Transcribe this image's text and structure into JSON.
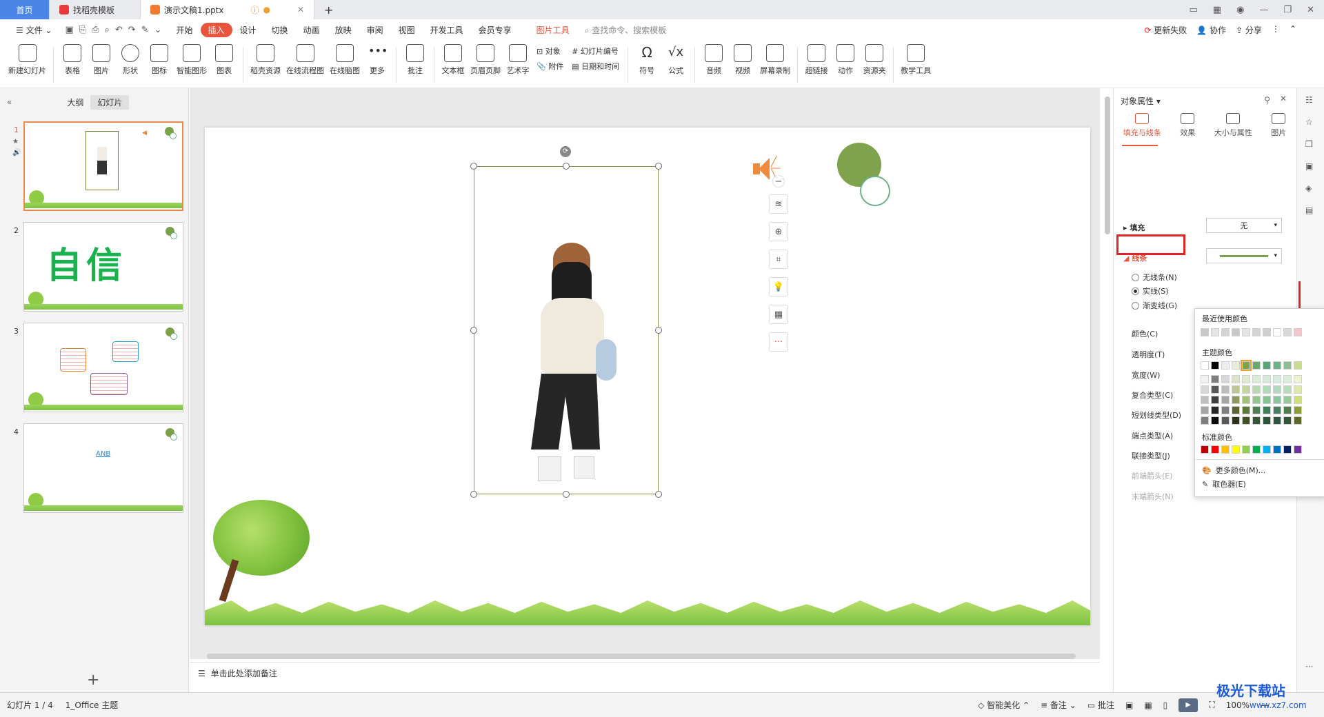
{
  "tabs": {
    "home": "首页",
    "template": "找稻壳模板",
    "doc": "演示文稿1.pptx"
  },
  "menu": {
    "file": "文件",
    "items": [
      "开始",
      "插入",
      "设计",
      "切换",
      "动画",
      "放映",
      "审阅",
      "视图",
      "开发工具",
      "会员专享"
    ],
    "active": "插入",
    "pic_tool": "图片工具",
    "search": "查找命令、搜索模板",
    "right": [
      "更新失败",
      "协作",
      "分享"
    ]
  },
  "ribbon": {
    "new_slide": "新建幻灯片",
    "table": "表格",
    "picture": "图片",
    "shape": "形状",
    "icon": "图标",
    "smart": "智能图形",
    "chart": "图表",
    "resource": "稻壳资源",
    "flowchart": "在线流程图",
    "mindmap": "在线脑图",
    "more": "更多",
    "comment": "批注",
    "textbox": "文本框",
    "header": "页眉页脚",
    "art": "艺术字",
    "object": "对象",
    "attach": "附件",
    "slide_num": "幻灯片编号",
    "datetime": "日期和时间",
    "symbol": "符号",
    "formula": "公式",
    "audio": "音频",
    "video": "视频",
    "screen": "屏幕录制",
    "link": "超链接",
    "action": "动作",
    "folder": "资源夹",
    "teach": "教学工具"
  },
  "left": {
    "outline": "大纲",
    "slides": "幻灯片",
    "numbers": [
      "1",
      "2",
      "3",
      "4"
    ],
    "slide2_text": "自信",
    "slide4_text": "ANB"
  },
  "notes": "单击此处添加备注",
  "pane": {
    "title": "对象属性",
    "tabs": [
      "填充与线条",
      "效果",
      "大小与属性",
      "图片"
    ],
    "fill": "填充",
    "fill_value": "无",
    "line": "线条",
    "no_line": "无线条(N)",
    "solid": "实线(S)",
    "gradient": "渐变线(G)",
    "color": "颜色(C)",
    "transparency": "透明度(T)",
    "width": "宽度(W)",
    "compound": "复合类型(C)",
    "dash": "短划线类型(D)",
    "cap": "端点类型(A)",
    "join": "联接类型(J)",
    "begin_arrow": "前端箭头(E)",
    "end_arrow": "末端箭头(N)",
    "line_color": "#7ea04d"
  },
  "colorpop": {
    "recent": "最近使用颜色",
    "theme": "主题颜色",
    "standard": "标准颜色",
    "more": "更多颜色(M)...",
    "picker": "取色器(E)",
    "standard_colors": [
      "#c00000",
      "#ff0000",
      "#ffc000",
      "#ffff00",
      "#92d050",
      "#00b050",
      "#00b0f0",
      "#0070c0",
      "#002060",
      "#7030a0"
    ]
  },
  "status": {
    "slide": "幻灯片 1 / 4",
    "theme": "1_Office 主题",
    "beautify": "智能美化",
    "notes": "备注",
    "comment": "批注",
    "zoom": "100%"
  },
  "watermark": {
    "name": "极光下载站",
    "url": "www.xz7.com"
  }
}
